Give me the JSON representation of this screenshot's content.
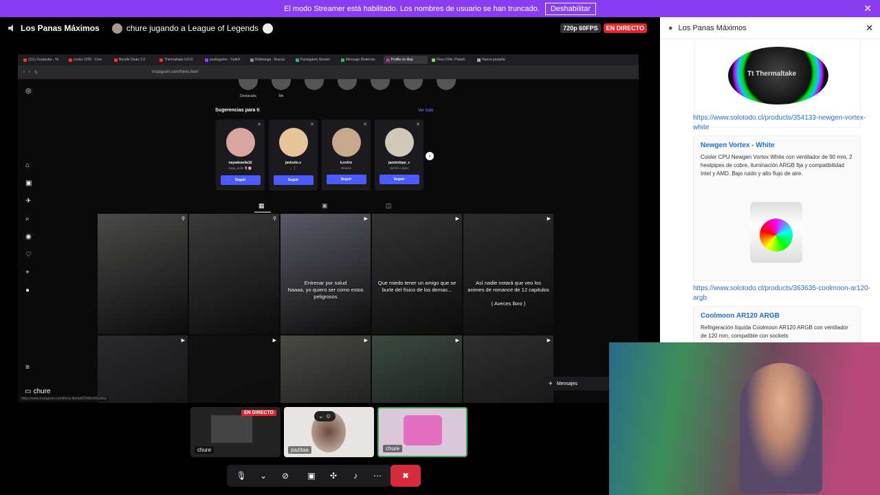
{
  "banner": {
    "text": "El modo Streamer está habilitado. Los nombres de usuario se han truncado.",
    "button": "Deshabilitar",
    "close": "✕"
  },
  "top": {
    "server": "Los Panas Máximos",
    "activity": "chure jugando a League of Legends",
    "quality": "720p 60FPS",
    "live": "EN DIRECTO"
  },
  "browser": {
    "tabs": [
      "(111) Guatauba - Yo",
      "cooler 1200 - Com",
      "Bundle Deals 2.0",
      "Thermaltake UX10",
      "pazitagame - Twitch",
      "Rollowage - Buscar",
      "Pastagame Stream",
      "Message Moderato",
      "Profile no disp",
      "Flow Chile: Platafo",
      "Nueva pestaña"
    ],
    "tab_colors": [
      "#e33",
      "#e33",
      "#e33",
      "#e33",
      "#9146ff",
      "#888",
      "#2bb673",
      "#2bb673",
      "#c13584",
      "#7d4",
      "#aaa"
    ],
    "url": "instagram.com/fores.lker/"
  },
  "ig": {
    "stories": [
      "Destacada",
      "Me",
      "",
      "",
      "",
      "",
      ""
    ],
    "suggestions_title": "Sugerencias para ti",
    "see_all": "Ver todo",
    "cards": [
      {
        "name": "nayadeavila15",
        "sub": "naya_avila 🌷🌸",
        "follow": "Seguir"
      },
      {
        "name": "javisoto.v",
        "sub": "♪ ❗",
        "follow": "Seguir"
      },
      {
        "name": "b.evtriz",
        "sub": "•Beatriz",
        "follow": "Seguir"
      },
      {
        "name": "jazminlope_z",
        "sub": "Jazmín López",
        "follow": "Seguir"
      }
    ],
    "captions": [
      "",
      "",
      "Entrenar por salud\nNaaaa, yo quiero ser como estos peligrosos",
      "Que miedo tener un amigo que se burle del físico de los demas...",
      "Así nadie notará que veo los animes de romance de 12 capitulos\n\n( Aveces lloro )"
    ],
    "messages": "Mensajes",
    "status_url": "https://www.instagram.com/fores.lker/p/DOhBvGKEdKp/"
  },
  "stage_user": "chure",
  "side": {
    "title": "Los Panas Máximos",
    "brand": "Tt Thermaltake",
    "link1": "https://www.solotodo.cl/products/354133-newgen-vortex-white",
    "embed1_title": "Newgen Vortex - White",
    "embed1_desc": "Cooler CPU Newgen Vortex White con ventilador de 90 mm, 2 heatpipes de cobre, iluminación ARGB fija y compatibilidad Intel y AMD. Bajo ruido y alto flujo de aire.",
    "link2": "https://www.solotodo.cl/products/363635-coolmoon-ar120-argb",
    "embed2_title": "Coolmoon AR120 ARGB",
    "embed2_desc": "Refrigeración líquida Coolmoon AR120 ARGB con ventilador de 120 mm, compatible con sockets"
  },
  "thumbs": [
    {
      "label": "chure",
      "live": "EN DIRECTO"
    },
    {
      "label": "pazitaa"
    },
    {
      "label": "chure"
    }
  ]
}
